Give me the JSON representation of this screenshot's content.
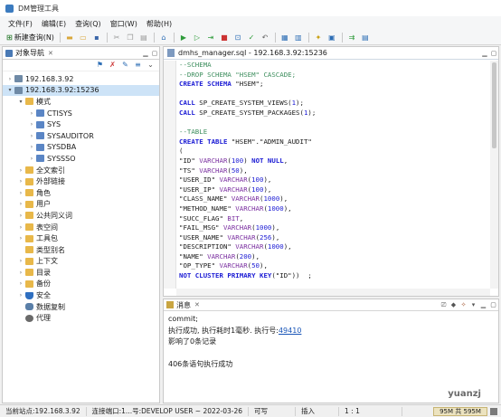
{
  "window": {
    "title": "DM管理工具"
  },
  "menu": [
    "文件(F)",
    "编辑(E)",
    "查询(Q)",
    "窗口(W)",
    "帮助(H)"
  ],
  "toolbar": {
    "new_query_label": "新建查询(N)"
  },
  "left_panel": {
    "tab_label": "对象导航",
    "tree": [
      {
        "label": "192.168.3.92",
        "depth": 0,
        "expanded": false,
        "icon": "server-icon",
        "selected": false
      },
      {
        "label": "192.168.3.92:15236",
        "depth": 0,
        "expanded": true,
        "icon": "server-icon",
        "selected": true
      },
      {
        "label": "模式",
        "depth": 1,
        "expanded": true,
        "icon": "folder-icon",
        "selected": false
      },
      {
        "label": "CTISYS",
        "depth": 2,
        "expanded": false,
        "icon": "schema-icon",
        "selected": false
      },
      {
        "label": "SYS",
        "depth": 2,
        "expanded": false,
        "icon": "schema-icon",
        "selected": false
      },
      {
        "label": "SYSAUDITOR",
        "depth": 2,
        "expanded": false,
        "icon": "schema-icon",
        "selected": false
      },
      {
        "label": "SYSDBA",
        "depth": 2,
        "expanded": false,
        "icon": "schema-icon",
        "selected": false
      },
      {
        "label": "SYSSSO",
        "depth": 2,
        "expanded": false,
        "icon": "schema-icon",
        "selected": false
      },
      {
        "label": "全文索引",
        "depth": 1,
        "expanded": false,
        "icon": "folder-icon",
        "selected": false
      },
      {
        "label": "外部链接",
        "depth": 1,
        "expanded": false,
        "icon": "folder-icon",
        "selected": false
      },
      {
        "label": "角色",
        "depth": 1,
        "expanded": false,
        "icon": "folder-icon",
        "selected": false
      },
      {
        "label": "用户",
        "depth": 1,
        "expanded": false,
        "icon": "folder-icon",
        "selected": false
      },
      {
        "label": "公共同义词",
        "depth": 1,
        "expanded": false,
        "icon": "folder-icon",
        "selected": false
      },
      {
        "label": "表空间",
        "depth": 1,
        "expanded": false,
        "icon": "folder-icon",
        "selected": false
      },
      {
        "label": "工具包",
        "depth": 1,
        "expanded": false,
        "icon": "folder-icon",
        "selected": false
      },
      {
        "label": "类型别名",
        "depth": 1,
        "expanded": false,
        "icon": "folder-icon",
        "selected": false,
        "leaf": true
      },
      {
        "label": "上下文",
        "depth": 1,
        "expanded": false,
        "icon": "folder-icon",
        "selected": false
      },
      {
        "label": "目录",
        "depth": 1,
        "expanded": false,
        "icon": "folder-icon",
        "selected": false
      },
      {
        "label": "备份",
        "depth": 1,
        "expanded": false,
        "icon": "folder-icon",
        "selected": false
      },
      {
        "label": "安全",
        "depth": 1,
        "expanded": false,
        "icon": "shield-icon",
        "selected": false
      },
      {
        "label": "数据复制",
        "depth": 1,
        "expanded": false,
        "icon": "database-icon",
        "selected": false,
        "leaf": true
      },
      {
        "label": "代理",
        "depth": 1,
        "expanded": false,
        "icon": "agent-icon",
        "selected": false,
        "leaf": true
      }
    ]
  },
  "editor": {
    "tab_label": "dmhs_manager.sql - 192.168.3.92:15236",
    "lines": [
      [
        [
          "cm",
          "--SCHEMA"
        ]
      ],
      [
        [
          "cm",
          "--DROP SCHEMA \"HSEM\" CASCADE;"
        ]
      ],
      [
        [
          "kw",
          "CREATE SCHEMA "
        ],
        [
          "st",
          "\"HSEM\";"
        ]
      ],
      [
        [
          "st",
          ""
        ]
      ],
      [
        [
          "kw",
          "CALL "
        ],
        [
          "st",
          "SP_CREATE_SYSTEM_VIEWS("
        ],
        [
          "nm",
          "1"
        ],
        [
          "st",
          ");"
        ]
      ],
      [
        [
          "kw",
          "CALL "
        ],
        [
          "st",
          "SP_CREATE_SYSTEM_PACKAGES("
        ],
        [
          "nm",
          "1"
        ],
        [
          "st",
          ");"
        ]
      ],
      [
        [
          "st",
          ""
        ]
      ],
      [
        [
          "cm",
          "--TABLE"
        ]
      ],
      [
        [
          "kw",
          "CREATE TABLE "
        ],
        [
          "st",
          "\"HSEM\".\"ADMIN_AUDIT\""
        ]
      ],
      [
        [
          "st",
          "("
        ]
      ],
      [
        [
          "st",
          "\"ID\" "
        ],
        [
          "tp",
          "VARCHAR"
        ],
        [
          "st",
          "("
        ],
        [
          "nm",
          "100"
        ],
        [
          "st",
          ") "
        ],
        [
          "kw",
          "NOT NULL"
        ],
        [
          "st",
          ","
        ]
      ],
      [
        [
          "st",
          "\"TS\" "
        ],
        [
          "tp",
          "VARCHAR"
        ],
        [
          "st",
          "("
        ],
        [
          "nm",
          "50"
        ],
        [
          "st",
          "),"
        ]
      ],
      [
        [
          "st",
          "\"USER_ID\" "
        ],
        [
          "tp",
          "VARCHAR"
        ],
        [
          "st",
          "("
        ],
        [
          "nm",
          "100"
        ],
        [
          "st",
          "),"
        ]
      ],
      [
        [
          "st",
          "\"USER_IP\" "
        ],
        [
          "tp",
          "VARCHAR"
        ],
        [
          "st",
          "("
        ],
        [
          "nm",
          "100"
        ],
        [
          "st",
          "),"
        ]
      ],
      [
        [
          "st",
          "\"CLASS_NAME\" "
        ],
        [
          "tp",
          "VARCHAR"
        ],
        [
          "st",
          "("
        ],
        [
          "nm",
          "1000"
        ],
        [
          "st",
          "),"
        ]
      ],
      [
        [
          "st",
          "\"METHOD_NAME\" "
        ],
        [
          "tp",
          "VARCHAR"
        ],
        [
          "st",
          "("
        ],
        [
          "nm",
          "1000"
        ],
        [
          "st",
          "),"
        ]
      ],
      [
        [
          "st",
          "\"SUCC_FLAG\" "
        ],
        [
          "tp",
          "BIT"
        ],
        [
          "st",
          ","
        ]
      ],
      [
        [
          "st",
          "\"FAIL_MSG\" "
        ],
        [
          "tp",
          "VARCHAR"
        ],
        [
          "st",
          "("
        ],
        [
          "nm",
          "1000"
        ],
        [
          "st",
          "),"
        ]
      ],
      [
        [
          "st",
          "\"USER_NAME\" "
        ],
        [
          "tp",
          "VARCHAR"
        ],
        [
          "st",
          "("
        ],
        [
          "nm",
          "256"
        ],
        [
          "st",
          "),"
        ]
      ],
      [
        [
          "st",
          "\"DESCRIPTION\" "
        ],
        [
          "tp",
          "VARCHAR"
        ],
        [
          "st",
          "("
        ],
        [
          "nm",
          "1000"
        ],
        [
          "st",
          "),"
        ]
      ],
      [
        [
          "st",
          "\"NAME\" "
        ],
        [
          "tp",
          "VARCHAR"
        ],
        [
          "st",
          "("
        ],
        [
          "nm",
          "200"
        ],
        [
          "st",
          "),"
        ]
      ],
      [
        [
          "st",
          "\"OP_TYPE\" "
        ],
        [
          "tp",
          "VARCHAR"
        ],
        [
          "st",
          "("
        ],
        [
          "nm",
          "50"
        ],
        [
          "st",
          "),"
        ]
      ],
      [
        [
          "kw",
          "NOT CLUSTER PRIMARY KEY"
        ],
        [
          "st",
          "(\"ID\"))  ;"
        ]
      ]
    ]
  },
  "messages": {
    "tab_label": "消息",
    "line_commit": "commit;",
    "line_exec_prefix": "执行成功, 执行耗时1毫秒. 执行号:",
    "exec_number": "49410",
    "line_affected": "影响了0条记录",
    "line_summary": "406条语句执行成功"
  },
  "status": {
    "site": "当前站点:192.168.3.92",
    "connection": "连接端口:1...号:DEVELOP USER ~ 2022-03-26",
    "writable": "可写",
    "insert_mode": "插入",
    "position": "1 : 1",
    "memory": "95M 共 595M"
  },
  "watermark": "yuanzj",
  "colors": {
    "comment": "#3f8f5f",
    "keyword": "#1c1cd4",
    "type": "#7a2fa0",
    "selection": "#cde3f7",
    "link": "#1a56b8"
  }
}
